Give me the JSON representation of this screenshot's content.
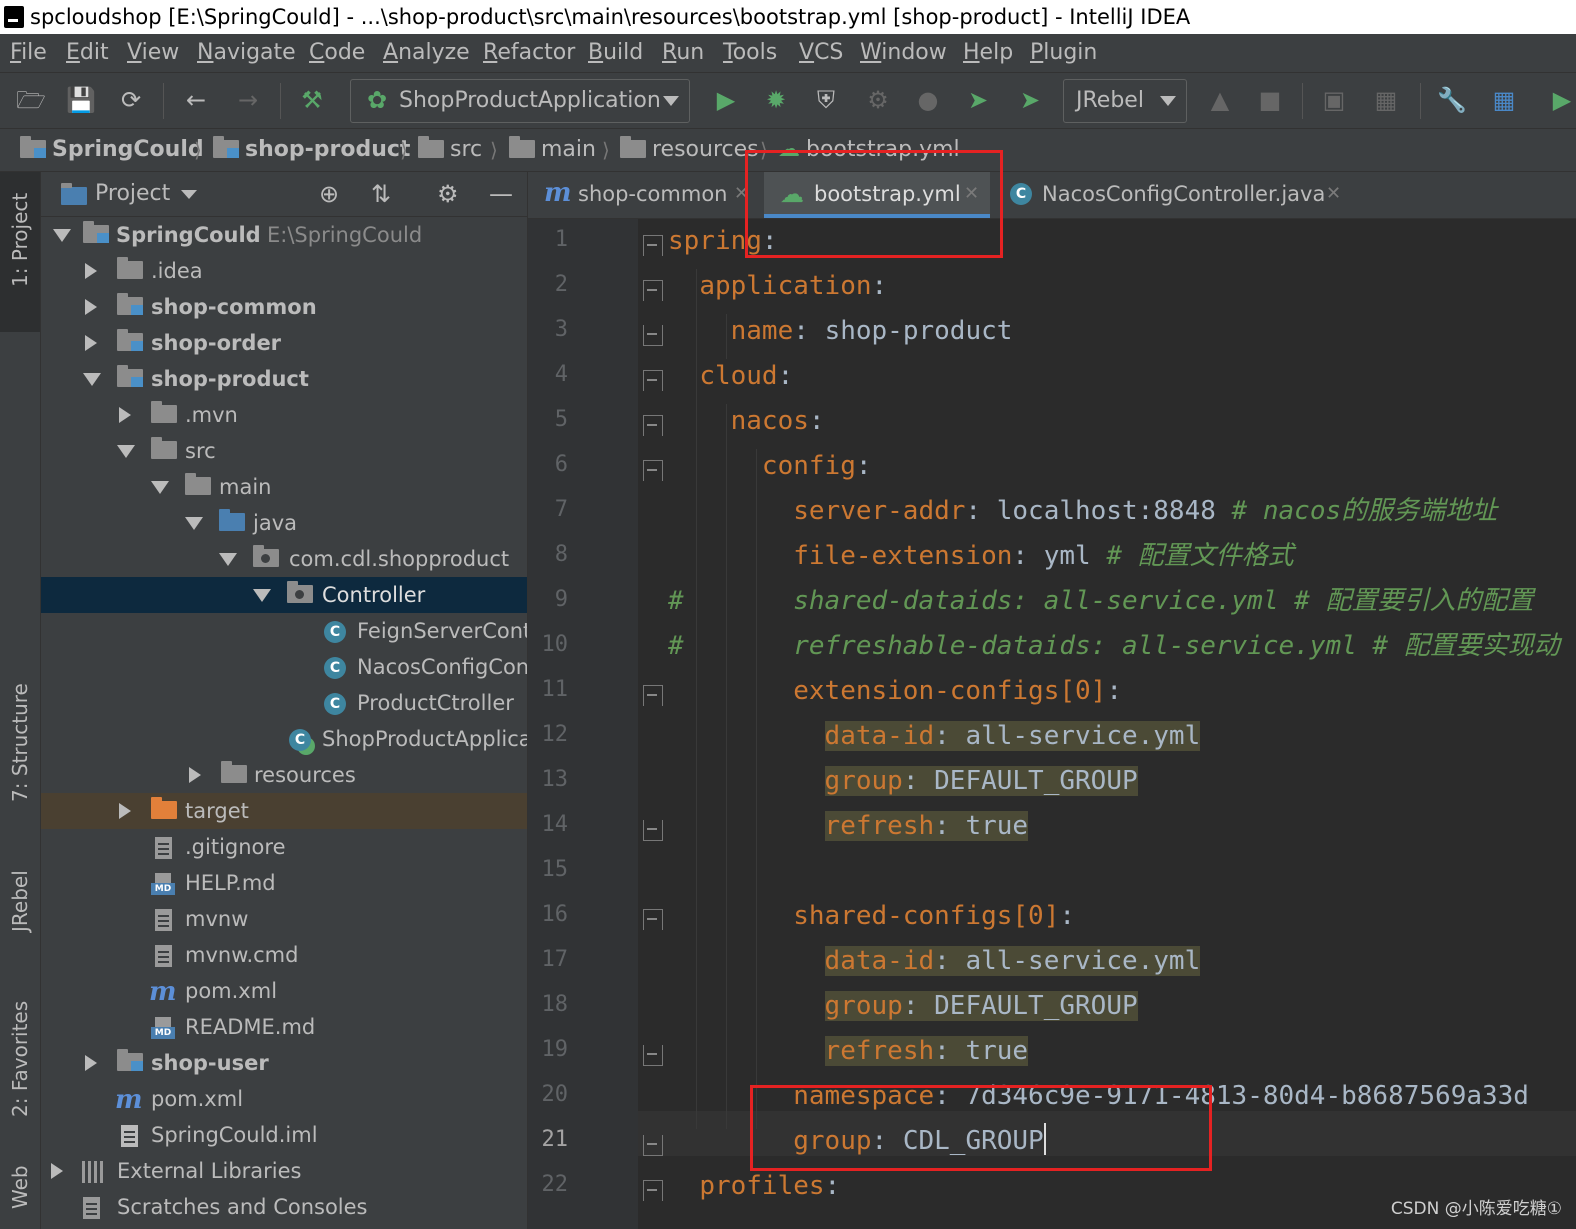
{
  "window": {
    "title": "spcloudshop [E:\\SpringCould] - ...\\shop-product\\src\\main\\resources\\bootstrap.yml [shop-product] - IntelliJ IDEA"
  },
  "menu": [
    "File",
    "Edit",
    "View",
    "Navigate",
    "Code",
    "Analyze",
    "Refactor",
    "Build",
    "Run",
    "Tools",
    "VCS",
    "Window",
    "Help",
    "Plugin"
  ],
  "toolbar": {
    "run_config": "ShopProductApplication",
    "jrebel": "JRebel"
  },
  "breadcrumb": [
    "SpringCould",
    "shop-product",
    "src",
    "main",
    "resources",
    "bootstrap.yml"
  ],
  "side_tabs": {
    "project": "1: Project",
    "structure": "7: Structure",
    "jrebel": "JRebel",
    "favorites": "2: Favorites",
    "web": "Web"
  },
  "project_panel": {
    "title": "Project"
  },
  "tree": [
    {
      "name": "SpringCould",
      "path": "E:\\SpringCould"
    },
    {
      "name": ".idea"
    },
    {
      "name": "shop-common"
    },
    {
      "name": "shop-order"
    },
    {
      "name": "shop-product"
    },
    {
      "name": ".mvn"
    },
    {
      "name": "src"
    },
    {
      "name": "main"
    },
    {
      "name": "java"
    },
    {
      "name": "com.cdl.shopproduct"
    },
    {
      "name": "Controller"
    },
    {
      "name": "FeignServerContr"
    },
    {
      "name": "NacosConfigCon"
    },
    {
      "name": "ProductCtroller"
    },
    {
      "name": "ShopProductApplica"
    },
    {
      "name": "resources"
    },
    {
      "name": "target"
    },
    {
      "name": ".gitignore"
    },
    {
      "name": "HELP.md"
    },
    {
      "name": "mvnw"
    },
    {
      "name": "mvnw.cmd"
    },
    {
      "name": "pom.xml"
    },
    {
      "name": "README.md"
    },
    {
      "name": "shop-user"
    },
    {
      "name": "pom.xml"
    },
    {
      "name": "SpringCould.iml"
    },
    {
      "name": "External Libraries"
    },
    {
      "name": "Scratches and Consoles"
    }
  ],
  "tabs": [
    {
      "label": "shop-common"
    },
    {
      "label": "bootstrap.yml"
    },
    {
      "label": "NacosConfigController.java"
    }
  ],
  "code": {
    "line_numbers": [
      "1",
      "2",
      "3",
      "4",
      "5",
      "6",
      "7",
      "8",
      "9",
      "10",
      "11",
      "12",
      "13",
      "14",
      "15",
      "16",
      "17",
      "18",
      "19",
      "20",
      "21",
      "22"
    ],
    "l1": {
      "k": "spring",
      "p": ":"
    },
    "l2": {
      "k": "application",
      "p": ":"
    },
    "l3": {
      "k": "name",
      "p": ": ",
      "v": "shop-product"
    },
    "l4": {
      "k": "cloud",
      "p": ":"
    },
    "l5": {
      "k": "nacos",
      "p": ":"
    },
    "l6": {
      "k": "config",
      "p": ":"
    },
    "l7": {
      "k": "server-addr",
      "p": ": ",
      "v": "localhost:8848 ",
      "c": "# nacos的服务端地址"
    },
    "l8": {
      "k": "file-extension",
      "p": ": ",
      "v": "yml ",
      "c": "# 配置文件格式"
    },
    "l9": {
      "c": "#       shared-dataids: all-service.yml # 配置要引入的配置"
    },
    "l10": {
      "c": "#       refreshable-dataids: all-service.yml # 配置要实现动"
    },
    "l11": {
      "k": "extension-configs[0]",
      "p": ":"
    },
    "l12": {
      "k": "data-id",
      "p": ": ",
      "v": "all-service.yml"
    },
    "l13": {
      "k": "group",
      "p": ": ",
      "v": "DEFAULT_GROUP"
    },
    "l14": {
      "k": "refresh",
      "p": ": ",
      "v": "true"
    },
    "l16": {
      "k": "shared-configs[0]",
      "p": ":"
    },
    "l17": {
      "k": "data-id",
      "p": ": ",
      "v": "all-service.yml"
    },
    "l18": {
      "k": "group",
      "p": ": ",
      "v": "DEFAULT_GROUP"
    },
    "l19": {
      "k": "refresh",
      "p": ": ",
      "v": "true"
    },
    "l20": {
      "k": "namespace",
      "p": ": ",
      "v": "7d346c9e-9171-4813-80d4-b8687569a33d"
    },
    "l21": {
      "k": "group",
      "p": ": ",
      "v": "CDL_GROUP"
    },
    "l22": {
      "k": "profiles",
      "p": ":"
    }
  },
  "watermark": "CSDN @小陈爱吃糖①",
  "colors": {
    "highlight_box": "#e52222",
    "keyword": "#cc7832",
    "value": "#a9b7c6",
    "comment": "#629755"
  }
}
